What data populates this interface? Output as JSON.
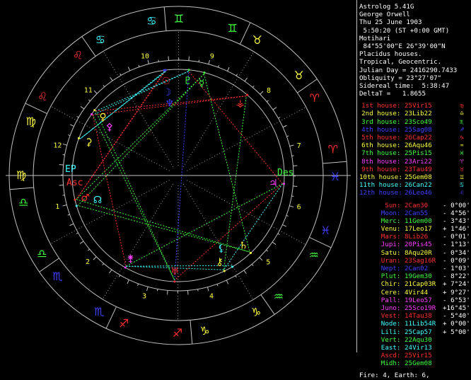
{
  "header": [
    "Astrolog 5.41G",
    "George Orwell",
    "Thu 25 June 1903",
    " 5:50:20 (ST +0:00 GMT)",
    "Motihari",
    " 84°55'00\"E 26°39'00\"N",
    "Placidus houses.",
    "Tropical, Geocentric.",
    "Julian Day = 2416290.7433",
    "Obliquity = 23°27'07\"",
    "Sidereal time:  5:38:47",
    "DeltaT =   1.8655"
  ],
  "houses": [
    {
      "label": "1st house:",
      "value": "25Vir15",
      "glyph": "♍",
      "color": "#ff3030"
    },
    {
      "label": "2nd house:",
      "value": "23Lib22",
      "glyph": "♎",
      "color": "#ffff40"
    },
    {
      "label": "3rd house:",
      "value": "23Sco49",
      "glyph": "♏",
      "color": "#40ff40"
    },
    {
      "label": "4th house:",
      "value": "25Sag08",
      "glyph": "♐",
      "color": "#4040ff"
    },
    {
      "label": "5th house:",
      "value": "26Cap22",
      "glyph": "♑",
      "color": "#ff3030"
    },
    {
      "label": "6th house:",
      "value": "26Aqu46",
      "glyph": "♒",
      "color": "#ffff40"
    },
    {
      "label": "7th house:",
      "value": "25Pis15",
      "glyph": "♓",
      "color": "#40ff40"
    },
    {
      "label": "8th house:",
      "value": "23Ari22",
      "glyph": "♈",
      "color": "#ff40ff"
    },
    {
      "label": "9th house:",
      "value": "23Tau49",
      "glyph": "♉",
      "color": "#ff3030"
    },
    {
      "label": "10th house:",
      "value": "25Gem08",
      "glyph": "♊",
      "color": "#ffff40"
    },
    {
      "label": "11th house:",
      "value": "26Can22",
      "glyph": "♋",
      "color": "#40ffff"
    },
    {
      "label": "12th house:",
      "value": "26Leo46",
      "glyph": "♌",
      "color": "#4040ff"
    }
  ],
  "planets": [
    {
      "label": "Sun:",
      "value": "2Can30",
      "extra": "- 0°00'",
      "glyph": "☉",
      "color": "#ff3030"
    },
    {
      "label": "Moon:",
      "value": "2Can55",
      "extra": "- 4°56'",
      "glyph": "☽",
      "color": "#4040ff"
    },
    {
      "label": "Merc:",
      "value": "11Gem00",
      "extra": "- 3°43'",
      "glyph": "☿",
      "color": "#40ff40"
    },
    {
      "label": "Venu:",
      "value": "17Leo17",
      "extra": "+ 1°46'",
      "glyph": "♀",
      "color": "#ffff40"
    },
    {
      "label": "Mars:",
      "value": "8Lib26",
      "extra": "- 0°01'",
      "glyph": "♂",
      "color": "#ff3030"
    },
    {
      "label": "Jupi:",
      "value": "20Pis45",
      "extra": "- 1°13'",
      "glyph": "♃",
      "color": "#ff40ff"
    },
    {
      "label": "Satu:",
      "value": "8Aqu20R",
      "extra": "- 0°34'",
      "glyph": "♄",
      "color": "#ffff40"
    },
    {
      "label": "Uran:",
      "value": "23Sag16R",
      "extra": "- 0°09'",
      "glyph": "♅",
      "color": "#ff3030"
    },
    {
      "label": "Nept:",
      "value": "2Can02",
      "extra": "- 1°03'",
      "glyph": "♆",
      "color": "#4040ff"
    },
    {
      "label": "Plut:",
      "value": "19Gem30",
      "extra": "- 8°22'",
      "glyph": "♇",
      "color": "#40ff40"
    },
    {
      "label": "Chir:",
      "value": "21Cap03R",
      "extra": "+ 7°24'",
      "glyph": "⚷",
      "color": "#ffff40"
    },
    {
      "label": "Cere:",
      "value": "4Vir44",
      "extra": "+ 9°27'",
      "glyph": "⚳",
      "color": "#ffff40"
    },
    {
      "label": "Pall:",
      "value": "19Leo57",
      "extra": "- 6°53'",
      "glyph": "⚴",
      "color": "#ff40ff"
    },
    {
      "label": "Juno:",
      "value": "25Sco19R",
      "extra": "+16°45'",
      "glyph": "⚵",
      "color": "#ff40ff"
    },
    {
      "label": "Vest:",
      "value": "14Tau38",
      "extra": "- 5°40'",
      "glyph": "⚶",
      "color": "#ff3030"
    },
    {
      "label": "Node:",
      "value": "11Lib54R",
      "extra": "+ 0°00'",
      "glyph": "☊",
      "color": "#40ffff"
    },
    {
      "label": "Lili:",
      "value": "25Cap57",
      "extra": "+ 5°00'",
      "glyph": "⚸",
      "color": "#40ffff"
    },
    {
      "label": "Vert:",
      "value": "22Aqu30",
      "extra": "",
      "glyph": "",
      "color": "#40ff40"
    },
    {
      "label": "East:",
      "value": "24Vir13",
      "extra": "",
      "glyph": "EP",
      "color": "#40ffff"
    },
    {
      "label": "Ascd:",
      "value": "25Vir15",
      "extra": "",
      "glyph": "As",
      "color": "#ff3030"
    },
    {
      "label": "Midh:",
      "value": "25Gem08",
      "extra": "",
      "glyph": "Mc",
      "color": "#40ff40"
    }
  ],
  "footer": "Fire: 4, Earth: 6,",
  "wheel": {
    "house_numbers": [
      "1",
      "2",
      "3",
      "4",
      "5",
      "6",
      "7",
      "8",
      "9",
      "10",
      "11",
      "12"
    ],
    "angle_labels": {
      "east": "EP",
      "asc": "Asc",
      "desc": "Des"
    },
    "colors": {
      "line": "#c0c0c0",
      "fire": "#ff3030",
      "earth": "#ffff40",
      "air": "#40ff40",
      "water": "#4040ff"
    }
  }
}
